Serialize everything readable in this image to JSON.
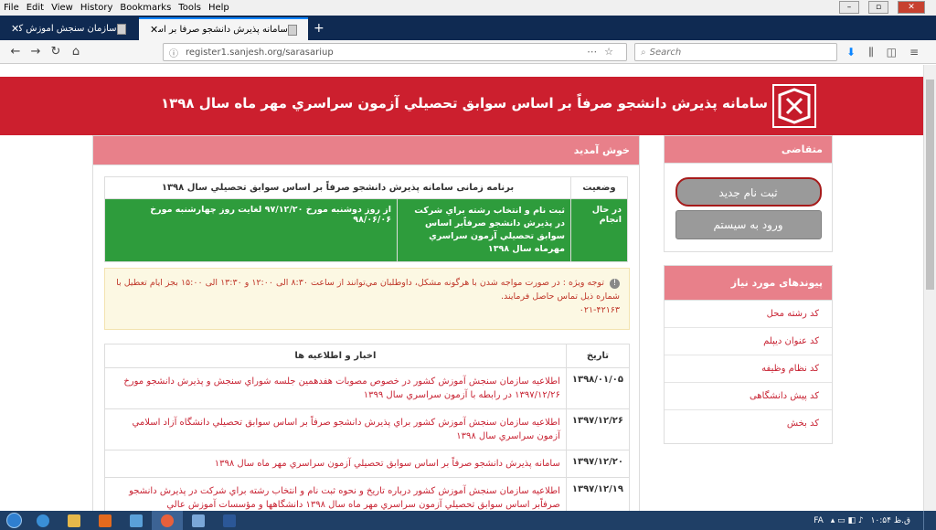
{
  "browser": {
    "menu": [
      "File",
      "Edit",
      "View",
      "History",
      "Bookmarks",
      "Tools",
      "Help"
    ],
    "tabs": [
      {
        "label": "سامانه پذيرش دانشجو صرفاً بر اساس سو",
        "active": true
      },
      {
        "label": "سازمان سنجش آموزش كشور",
        "active": false
      }
    ],
    "new_tab": "+",
    "url": "register1.sanjesh.org/sarasariup",
    "search_placeholder": "Search"
  },
  "header": {
    "title": "سامانه پذيرش دانشجو صرفاً بر اساس سوابق تحصيلي آزمون سراسري مهر ماه سال ۱۳۹۸"
  },
  "sidebar": {
    "applicant": {
      "heading": "متقاضی",
      "register_button": "ثبت نام جدید",
      "login_button": "ورود به سیستم"
    },
    "links": {
      "heading": "پیوندهای مورد نیاز",
      "items": [
        "کد رشته محل",
        "کد عنوان دیپلم",
        "کد نظام وظیفه",
        "کد پیش دانشگاهی",
        "کد بخش"
      ]
    }
  },
  "main": {
    "welcome": "خوش آمدید",
    "schedule": {
      "status_header": "وضعيت",
      "title_header": "برنامه زمانی سامانه پذيرش دانشجو صرفاً بر اساس سوابق تحصيلي سال ۱۳۹۸",
      "status": "در حال انجام",
      "activity": "ثبت نام و انتخاب رشته براي شركت در پذيرش دانشجو صرفاًبر اساس سوابق تحصيلي آزمون سراسري مهرماه سال ۱۳۹۸",
      "period": "از روز دوشنبه مورخ ۹۷/۱۲/۲۰ لغايت روز چهارشنبه مورخ ۹۸/۰۶/۰۶"
    },
    "notice": "توجه ويژه : در صورت مواجه شدن با هرگونه مشكل، داوطلبان مي‌توانند از ساعت ۸:۳۰ الی ۱۲:۰۰ و ۱۳:۳۰ الی ۱۵:۰۰ بجز ایام تعطیل با شماره ذیل تماس حاصل فرمایند.",
    "notice_phone": "۰۲۱-۴۲۱۶۳",
    "news": {
      "date_header": "تاریخ",
      "title_header": "اخبار و اطلاعیه ها",
      "rows": [
        {
          "date": "۱۳۹۸/۰۱/۰۵",
          "text": "اطلاعيه سازمان سنجش آموزش كشور در خصوص مصوبات هفدهمين جلسه شوراي سنجش و پذيرش دانشجو مورخ ۱۳۹۷/۱۲/۲۶ در رابطه با آزمون سراسري سال ۱۳۹۹"
        },
        {
          "date": "۱۳۹۷/۱۲/۲۶",
          "text": "اطلاعيه سازمان سنجش آموزش كشور براي پذيرش دانشجو صرفاً بر اساس سوابق تحصيلي دانشگاه آزاد اسلامي آزمون سراسري سال ۱۳۹۸"
        },
        {
          "date": "۱۳۹۷/۱۲/۲۰",
          "text": "سامانه پذيرش دانشجو صرفاً بر اساس سوابق تحصيلي آزمون سراسري مهر ماه سال ۱۳۹۸"
        },
        {
          "date": "۱۳۹۷/۱۲/۱۹",
          "text": "اطلاعيه سازمان سنجش آموزش كشور درباره تاريخ و نحوه ثبت نام و انتخاب رشته براي شركت در پذيرش دانشجو صرفاًبر اساس سوابق تحصيلي آزمون سراسري مهر ماه سال ۱۳۹۸ دانشگاهها و مؤسسات آموزش عالي"
        }
      ]
    }
  },
  "taskbar": {
    "lang": "FA",
    "clock": "۱۰:۵۴ ق.ظ"
  },
  "colors": {
    "banner": "#cc1f2e",
    "card_head": "#e8808a",
    "status_green": "#2e9c3c",
    "link_red": "#c82333"
  }
}
